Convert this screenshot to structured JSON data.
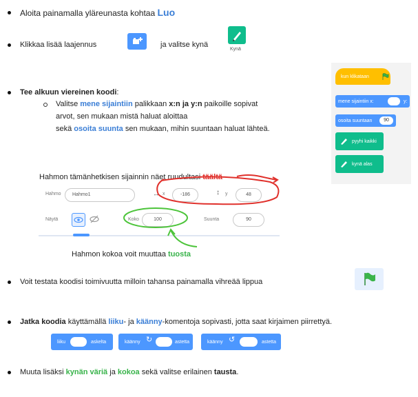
{
  "item1": {
    "text": "Aloita painamalla yläreunasta kohtaa ",
    "highlight": "Luo"
  },
  "item2": {
    "text_before": "Klikkaa lisää laajennus",
    "text_after": "ja valitse kynä",
    "pen_caption": "Kynä"
  },
  "item3": {
    "heading": "Tee alkuun viereinen koodi",
    "heading_suffix": ":",
    "sub1_prefix": "Valitse ",
    "sub1_highlight": "mene sijaintiin",
    "sub1_mid": " palikkaan ",
    "sub1_bold": "x:n ja y:n",
    "sub1_suffix": " paikoille sopivat",
    "sub1_line2": "arvot, sen mukaan mistä haluat aloittaa",
    "sub1_line3_prefix": "sekä ",
    "sub1_line3_highlight": "osoita suunta",
    "sub1_line3_suffix": " sen mukaan, mihin suuntaan haluat lähteä."
  },
  "position_note": {
    "text": "Hahmon tämänhetkisen sijainnin näet ruudultasi ",
    "highlight": "täältä"
  },
  "sprite_panel": {
    "sprite_label": "Hahmo",
    "sprite_name": "Hahmo1",
    "x_label": "x",
    "x_value": "-186",
    "y_label": "y",
    "y_value": "48",
    "show_label": "Näytä",
    "size_label": "Koko",
    "size_value": "100",
    "direction_label": "Suunta",
    "direction_value": "90"
  },
  "size_note": {
    "text": "Hahmon kokoa voit muuttaa ",
    "highlight": "tuosta"
  },
  "item4": {
    "text": "Voit testata koodisi toimivuutta milloin tahansa painamalla vihreää lippua"
  },
  "item5": {
    "bold": "Jatka koodia",
    "t1": " käyttämällä ",
    "h1": "liiku",
    "t2": "- ja ",
    "h2": "käänny",
    "t3": "-komentoja sopivasti, jotta saat kirjaimen piirrettyä."
  },
  "motion_blocks": {
    "move": {
      "prefix": "liiku",
      "suffix": "askelta"
    },
    "turn_right": {
      "prefix": "käänny",
      "suffix": "astetta"
    },
    "turn_left": {
      "prefix": "käänny",
      "suffix": "astetta"
    }
  },
  "item6": {
    "t1": "Muuta lisäksi ",
    "h1": "kynän väriä",
    "t2": " ja ",
    "h2": "kokoa",
    "t3": " sekä valitse erilainen ",
    "b1": "tausta",
    "t4": "."
  },
  "code_blocks": {
    "hat": "kun klikataan",
    "goto_prefix": "mene sijaintiin x:",
    "goto_suffix": "y:",
    "point": "osoita suuntaan",
    "point_value": "90",
    "pen_down": "pyyhi kaikki",
    "pen_clear": "kynä alas"
  },
  "colors": {
    "blue": "#3a7ed6",
    "green": "#38b34a",
    "red": "#e0302b",
    "events": "#ffbf00",
    "motion": "#4c97ff",
    "pen": "#0fbd8c"
  }
}
